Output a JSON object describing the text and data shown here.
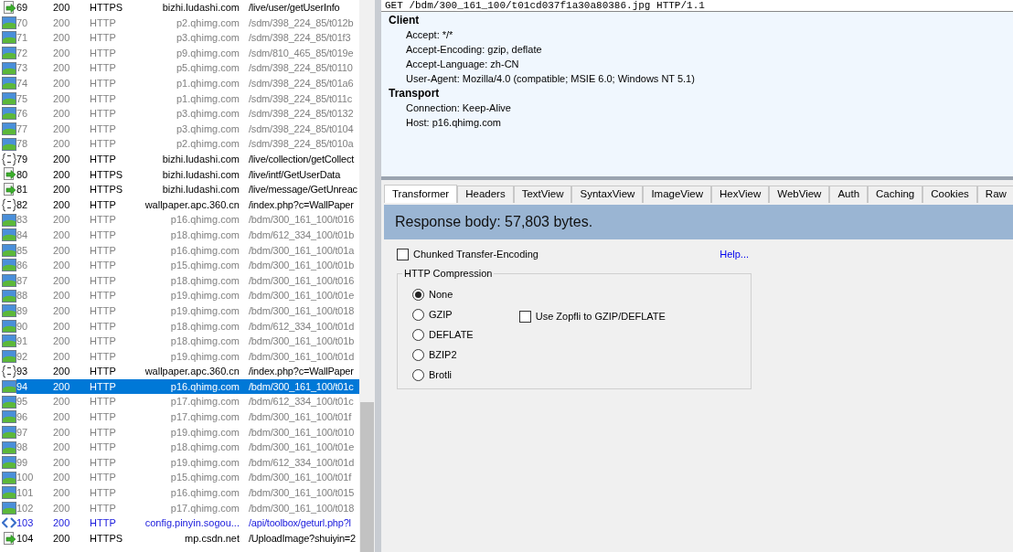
{
  "sessions": {
    "rows": [
      {
        "kind": "arrow",
        "num": "69",
        "result": "200",
        "protocol": "HTTPS",
        "host": "bizhi.ludashi.com",
        "url": "/live/user/getUserInfo",
        "selected": false
      },
      {
        "kind": "image",
        "num": "70",
        "result": "200",
        "protocol": "HTTP",
        "host": "p2.qhimg.com",
        "url": "/sdm/398_224_85/t012b",
        "selected": false
      },
      {
        "kind": "image",
        "num": "71",
        "result": "200",
        "protocol": "HTTP",
        "host": "p3.qhimg.com",
        "url": "/sdm/398_224_85/t01f3",
        "selected": false
      },
      {
        "kind": "image",
        "num": "72",
        "result": "200",
        "protocol": "HTTP",
        "host": "p9.qhimg.com",
        "url": "/sdm/810_465_85/t019e",
        "selected": false
      },
      {
        "kind": "image",
        "num": "73",
        "result": "200",
        "protocol": "HTTP",
        "host": "p5.qhimg.com",
        "url": "/sdm/398_224_85/t0110",
        "selected": false
      },
      {
        "kind": "image",
        "num": "74",
        "result": "200",
        "protocol": "HTTP",
        "host": "p1.qhimg.com",
        "url": "/sdm/398_224_85/t01a6",
        "selected": false
      },
      {
        "kind": "image",
        "num": "75",
        "result": "200",
        "protocol": "HTTP",
        "host": "p1.qhimg.com",
        "url": "/sdm/398_224_85/t011c",
        "selected": false
      },
      {
        "kind": "image",
        "num": "76",
        "result": "200",
        "protocol": "HTTP",
        "host": "p3.qhimg.com",
        "url": "/sdm/398_224_85/t0132",
        "selected": false
      },
      {
        "kind": "image",
        "num": "77",
        "result": "200",
        "protocol": "HTTP",
        "host": "p3.qhimg.com",
        "url": "/sdm/398_224_85/t0104",
        "selected": false
      },
      {
        "kind": "image",
        "num": "78",
        "result": "200",
        "protocol": "HTTP",
        "host": "p2.qhimg.com",
        "url": "/sdm/398_224_85/t010a",
        "selected": false
      },
      {
        "kind": "js",
        "num": "79",
        "result": "200",
        "protocol": "HTTP",
        "host": "bizhi.ludashi.com",
        "url": "/live/collection/getCollect",
        "selected": false
      },
      {
        "kind": "arrow",
        "num": "80",
        "result": "200",
        "protocol": "HTTPS",
        "host": "bizhi.ludashi.com",
        "url": "/live/intf/GetUserData",
        "selected": false
      },
      {
        "kind": "arrow",
        "num": "81",
        "result": "200",
        "protocol": "HTTPS",
        "host": "bizhi.ludashi.com",
        "url": "/live/message/GetUnreac",
        "selected": false
      },
      {
        "kind": "js",
        "num": "82",
        "result": "200",
        "protocol": "HTTP",
        "host": "wallpaper.apc.360.cn",
        "url": "/index.php?c=WallPaper",
        "selected": false
      },
      {
        "kind": "image",
        "num": "83",
        "result": "200",
        "protocol": "HTTP",
        "host": "p16.qhimg.com",
        "url": "/bdm/300_161_100/t016",
        "selected": false
      },
      {
        "kind": "image",
        "num": "84",
        "result": "200",
        "protocol": "HTTP",
        "host": "p18.qhimg.com",
        "url": "/bdm/612_334_100/t01b",
        "selected": false
      },
      {
        "kind": "image",
        "num": "85",
        "result": "200",
        "protocol": "HTTP",
        "host": "p16.qhimg.com",
        "url": "/bdm/300_161_100/t01a",
        "selected": false
      },
      {
        "kind": "image",
        "num": "86",
        "result": "200",
        "protocol": "HTTP",
        "host": "p15.qhimg.com",
        "url": "/bdm/300_161_100/t01b",
        "selected": false
      },
      {
        "kind": "image",
        "num": "87",
        "result": "200",
        "protocol": "HTTP",
        "host": "p18.qhimg.com",
        "url": "/bdm/300_161_100/t016",
        "selected": false
      },
      {
        "kind": "image",
        "num": "88",
        "result": "200",
        "protocol": "HTTP",
        "host": "p19.qhimg.com",
        "url": "/bdm/300_161_100/t01e",
        "selected": false
      },
      {
        "kind": "image",
        "num": "89",
        "result": "200",
        "protocol": "HTTP",
        "host": "p19.qhimg.com",
        "url": "/bdm/300_161_100/t018",
        "selected": false
      },
      {
        "kind": "image",
        "num": "90",
        "result": "200",
        "protocol": "HTTP",
        "host": "p18.qhimg.com",
        "url": "/bdm/612_334_100/t01d",
        "selected": false
      },
      {
        "kind": "image",
        "num": "91",
        "result": "200",
        "protocol": "HTTP",
        "host": "p18.qhimg.com",
        "url": "/bdm/300_161_100/t01b",
        "selected": false
      },
      {
        "kind": "image",
        "num": "92",
        "result": "200",
        "protocol": "HTTP",
        "host": "p19.qhimg.com",
        "url": "/bdm/300_161_100/t01d",
        "selected": false
      },
      {
        "kind": "js",
        "num": "93",
        "result": "200",
        "protocol": "HTTP",
        "host": "wallpaper.apc.360.cn",
        "url": "/index.php?c=WallPaper",
        "selected": false
      },
      {
        "kind": "image",
        "num": "94",
        "result": "200",
        "protocol": "HTTP",
        "host": "p16.qhimg.com",
        "url": "/bdm/300_161_100/t01c",
        "selected": true
      },
      {
        "kind": "image",
        "num": "95",
        "result": "200",
        "protocol": "HTTP",
        "host": "p17.qhimg.com",
        "url": "/bdm/612_334_100/t01c",
        "selected": false
      },
      {
        "kind": "image",
        "num": "96",
        "result": "200",
        "protocol": "HTTP",
        "host": "p17.qhimg.com",
        "url": "/bdm/300_161_100/t01f",
        "selected": false
      },
      {
        "kind": "image",
        "num": "97",
        "result": "200",
        "protocol": "HTTP",
        "host": "p19.qhimg.com",
        "url": "/bdm/300_161_100/t010",
        "selected": false
      },
      {
        "kind": "image",
        "num": "98",
        "result": "200",
        "protocol": "HTTP",
        "host": "p18.qhimg.com",
        "url": "/bdm/300_161_100/t01e",
        "selected": false
      },
      {
        "kind": "image",
        "num": "99",
        "result": "200",
        "protocol": "HTTP",
        "host": "p19.qhimg.com",
        "url": "/bdm/612_334_100/t01d",
        "selected": false
      },
      {
        "kind": "image",
        "num": "100",
        "result": "200",
        "protocol": "HTTP",
        "host": "p15.qhimg.com",
        "url": "/bdm/300_161_100/t01f",
        "selected": false
      },
      {
        "kind": "image",
        "num": "101",
        "result": "200",
        "protocol": "HTTP",
        "host": "p16.qhimg.com",
        "url": "/bdm/300_161_100/t015",
        "selected": false
      },
      {
        "kind": "image",
        "num": "102",
        "result": "200",
        "protocol": "HTTP",
        "host": "p17.qhimg.com",
        "url": "/bdm/300_161_100/t018",
        "selected": false
      },
      {
        "kind": "code",
        "num": "103",
        "result": "200",
        "protocol": "HTTP",
        "host": "config.pinyin.sogou...",
        "url": "/api/toolbox/geturl.php?l",
        "selected": false
      },
      {
        "kind": "arrow",
        "num": "104",
        "result": "200",
        "protocol": "HTTPS",
        "host": "mp.csdn.net",
        "url": "/UploadImage?shuiyin=2",
        "selected": false
      }
    ]
  },
  "request": {
    "request_line": "GET /bdm/300_161_100/t01cd037f1a30a80386.jpg HTTP/1.1",
    "groups": [
      {
        "name": "Client",
        "headers": [
          "Accept: */*",
          "Accept-Encoding: gzip, deflate",
          "Accept-Language: zh-CN",
          "User-Agent: Mozilla/4.0 (compatible; MSIE 6.0; Windows NT 5.1)"
        ]
      },
      {
        "name": "Transport",
        "headers": [
          "Connection: Keep-Alive",
          "Host: p16.qhimg.com"
        ]
      }
    ]
  },
  "response": {
    "tabs": [
      {
        "label": "Transformer",
        "selected": true
      },
      {
        "label": "Headers",
        "selected": false
      },
      {
        "label": "TextView",
        "selected": false
      },
      {
        "label": "SyntaxView",
        "selected": false
      },
      {
        "label": "ImageView",
        "selected": false
      },
      {
        "label": "HexView",
        "selected": false
      },
      {
        "label": "WebView",
        "selected": false
      },
      {
        "label": "Auth",
        "selected": false
      },
      {
        "label": "Caching",
        "selected": false
      },
      {
        "label": "Cookies",
        "selected": false
      },
      {
        "label": "Raw",
        "selected": false
      }
    ],
    "banner": "Response body: 57,803 bytes.",
    "chunked": {
      "label": "Chunked Transfer-Encoding",
      "checked": false
    },
    "help_link": "Help...",
    "compression": {
      "title": "HTTP Compression",
      "options": [
        {
          "label": "None",
          "selected": true
        },
        {
          "label": "GZIP",
          "selected": false
        },
        {
          "label": "DEFLATE",
          "selected": false
        },
        {
          "label": "BZIP2",
          "selected": false
        },
        {
          "label": "Brotli",
          "selected": false
        }
      ],
      "zopfli": {
        "label": "Use Zopfli to GZIP/DEFLATE",
        "checked": false
      }
    }
  }
}
